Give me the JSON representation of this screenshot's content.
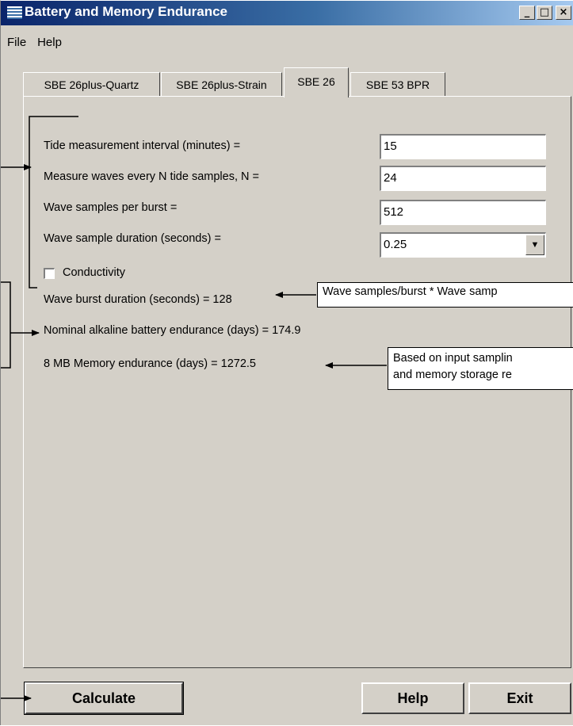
{
  "window": {
    "title": "Battery and Memory Endurance",
    "controls": {
      "minimize": "_",
      "maximize": "□",
      "close": "×"
    }
  },
  "menu": [
    "File",
    "Help"
  ],
  "tabs": [
    {
      "label": "SBE 26plus-Quartz",
      "active": false
    },
    {
      "label": "SBE 26plus-Strain",
      "active": false
    },
    {
      "label": "SBE 26",
      "active": true
    },
    {
      "label": "SBE 53 BPR",
      "active": false
    }
  ],
  "form": {
    "tide_interval": {
      "label": "Tide measurement interval (minutes) =",
      "value": "15"
    },
    "waves_every_n": {
      "label": "Measure waves every N tide samples, N =",
      "value": "24"
    },
    "wave_samples": {
      "label": "Wave samples per burst =",
      "value": "512"
    },
    "wave_duration": {
      "label": "Wave sample duration (seconds) =",
      "value": "0.25"
    },
    "conductivity": {
      "label": "Conductivity",
      "checked": false
    }
  },
  "results": {
    "burst_duration": "Wave burst duration (seconds) = 128",
    "battery": "Nominal alkaline battery endurance (days) = 174.9",
    "memory": "8 MB Memory endurance (days) = 1272.5"
  },
  "callouts": {
    "burst": "Wave samples/burst * Wave samp",
    "memory_line1": "Based on input samplin",
    "memory_line2": "and memory storage re"
  },
  "buttons": {
    "calculate": "Calculate",
    "help": "Help",
    "exit": "Exit"
  }
}
